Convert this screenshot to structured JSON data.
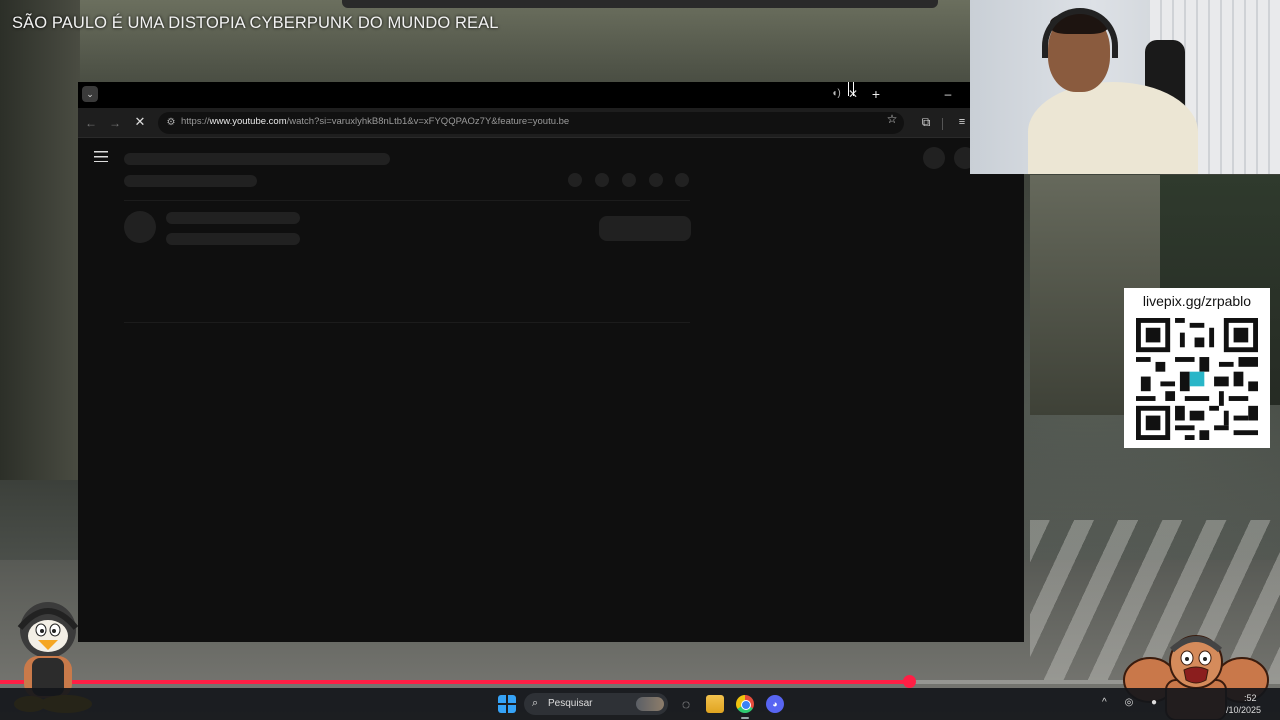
{
  "overlay": {
    "stream_title": "SÃO PAULO É UMA DISTOPIA CYBERPUNK DO MUNDO REAL",
    "qr_label": "livepix.gg/zrpablo"
  },
  "browser": {
    "url_prefix": "https://",
    "url_host": "www.youtube.com",
    "url_path": "/watch?si=varuxlyhkB8nLtb1&v=xFYQQPAOz7Y&feature=youtu.be",
    "tab_state": "loading"
  },
  "playback": {
    "progress_fraction": 0.71
  },
  "taskbar": {
    "search_placeholder": "Pesquisar",
    "clock_time": ":52",
    "clock_date": "/10/2025",
    "apps": [
      "copilot-icon",
      "file-explorer-icon",
      "chrome-icon",
      "discord-icon"
    ]
  },
  "colors": {
    "accent_progress": "#ff1f45",
    "page_bg": "#0f0f0f",
    "skeleton": "#212121"
  }
}
